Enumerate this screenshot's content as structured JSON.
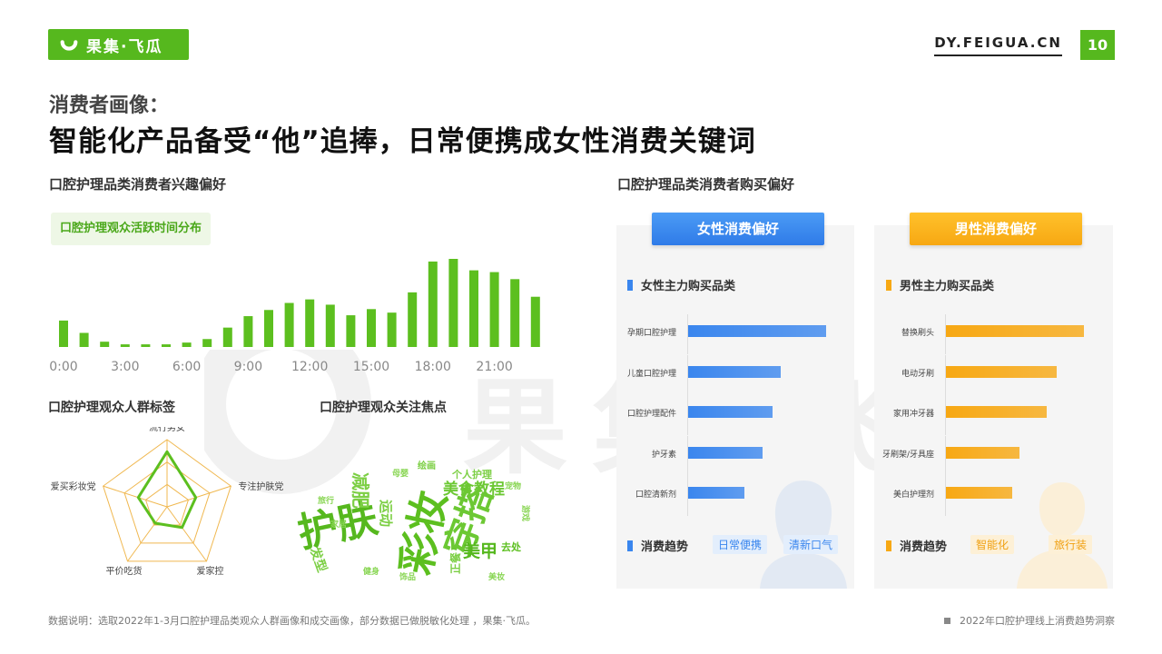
{
  "header": {
    "logo_text": "果集·飞瓜",
    "site": "DY.FEIGUA.CN",
    "page_number": "10",
    "subtitle": "消费者画像：",
    "title": "智能化产品备受“他”追捧，日常便携成女性消费关键词"
  },
  "watermark": {
    "text": "果集·飞瓜"
  },
  "left": {
    "section_title": "口腔护理品类消费者兴趣偏好",
    "chart_chip": "口腔护理观众活跃时间分布",
    "radar_title": "口腔护理观众人群标签",
    "cloud_title": "口腔护理观众关注焦点"
  },
  "chart_data": [
    {
      "type": "bar",
      "x_tick_labels": [
        "0:00",
        "3:00",
        "6:00",
        "9:00",
        "12:00",
        "15:00",
        "18:00",
        "21:00"
      ],
      "categories": [
        "0",
        "1",
        "2",
        "3",
        "4",
        "5",
        "6",
        "7",
        "8",
        "9",
        "10",
        "11",
        "12",
        "13",
        "14",
        "15",
        "16",
        "17",
        "18",
        "19",
        "20",
        "21",
        "22",
        "23"
      ],
      "values": [
        30,
        16,
        6,
        3,
        3,
        3,
        5,
        9,
        22,
        35,
        42,
        50,
        54,
        48,
        36,
        43,
        39,
        62,
        97,
        100,
        87,
        85,
        77,
        57
      ],
      "color": "#5cbf1f"
    },
    {
      "type": "radar",
      "axes": [
        "流行男女",
        "专注护肤党",
        "爱家控",
        "平价吃货",
        "爱买彩妆党"
      ],
      "values": [
        0.82,
        0.45,
        0.38,
        0.3,
        0.45
      ],
      "grid_levels": 3,
      "color": "#5cbf1f",
      "grid_color": "#f0b850"
    }
  ],
  "word_cloud": {
    "words": [
      {
        "text": "护肤",
        "color": "#56b81e"
      },
      {
        "text": "彩妆",
        "color": "#5cbf1f"
      },
      {
        "text": "穿搭",
        "color": "#6cc833"
      },
      {
        "text": "美食教程",
        "color": "#6cc833"
      },
      {
        "text": "美甲",
        "color": "#56b81e"
      },
      {
        "text": "减肥",
        "color": "#7ccf44"
      },
      {
        "text": "运动",
        "color": "#7ccf44"
      },
      {
        "text": "发型",
        "color": "#7ccf44"
      },
      {
        "text": "个人护理",
        "color": "#7ccf44"
      },
      {
        "text": "去处",
        "color": "#5cbf1f"
      },
      {
        "text": "绘画",
        "color": "#7ccf44"
      },
      {
        "text": "正餐",
        "color": "#7ccf44"
      },
      {
        "text": "美妆",
        "color": "#8ad655"
      },
      {
        "text": "家居",
        "color": "#8ad655"
      },
      {
        "text": "健身",
        "color": "#8ad655"
      },
      {
        "text": "游戏",
        "color": "#8ad655"
      },
      {
        "text": "饰品",
        "color": "#8ad655"
      },
      {
        "text": "宠物",
        "color": "#8ad655"
      },
      {
        "text": "母婴",
        "color": "#8ad655"
      },
      {
        "text": "旅行",
        "color": "#8ad655"
      }
    ]
  },
  "right": {
    "section_title": "口腔护理品类消费者购买偏好",
    "female": {
      "header": "女性消费偏好",
      "main_title": "女性主力购买品类",
      "color": "#3a86ee",
      "items": [
        {
          "label": "孕期口腔护理",
          "value": 1.0
        },
        {
          "label": "儿童口腔护理",
          "value": 0.67
        },
        {
          "label": "口腔护理配件",
          "value": 0.61
        },
        {
          "label": "护牙素",
          "value": 0.54
        },
        {
          "label": "口腔清新剂",
          "value": 0.41
        }
      ],
      "trend_title": "消费趋势",
      "tags": [
        "日常便携",
        "清新口气"
      ],
      "tag_bg": "#e3eefc",
      "tag_color": "#3a86ee"
    },
    "male": {
      "header": "男性消费偏好",
      "main_title": "男性主力购买品类",
      "color": "#f7a813",
      "items": [
        {
          "label": "替换刷头",
          "value": 1.0
        },
        {
          "label": "电动牙刷",
          "value": 0.8
        },
        {
          "label": "家用冲牙器",
          "value": 0.73
        },
        {
          "label": "牙刷架/牙具座",
          "value": 0.53
        },
        {
          "label": "美白护理剂",
          "value": 0.48
        }
      ],
      "trend_title": "消费趋势",
      "tags": [
        "智能化",
        "旅行装"
      ],
      "tag_bg": "#fdf0d6",
      "tag_color": "#f0a010"
    }
  },
  "footer": {
    "note": "数据说明：选取2022年1-3月口腔护理品类观众人群画像和成交画像，部分数据已做脱敏化处理 ，果集·飞瓜。",
    "report": "2022年口腔护理线上消费趋势洞察"
  }
}
